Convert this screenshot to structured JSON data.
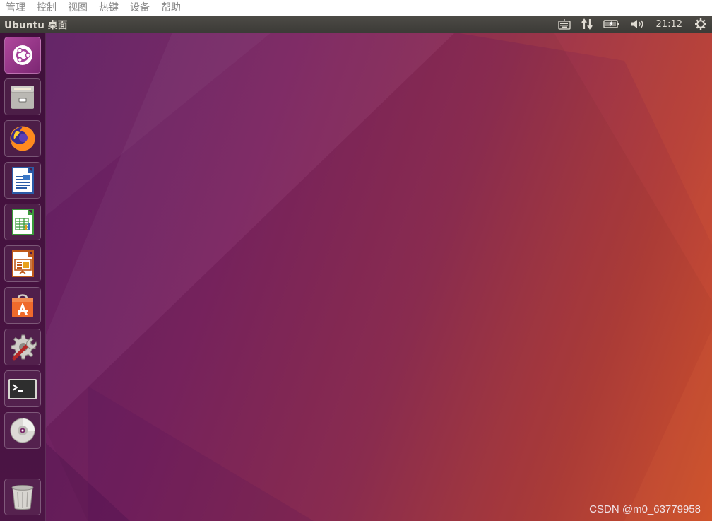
{
  "vbox_menu": {
    "items": [
      "管理",
      "控制",
      "视图",
      "热键",
      "设备",
      "帮助"
    ]
  },
  "top_panel": {
    "title": "Ubuntu 桌面",
    "indicators": [
      "keyboard-icon",
      "network-icon",
      "battery-icon",
      "volume-icon"
    ],
    "clock": "21:12",
    "session_icon": "gear-icon"
  },
  "launcher": {
    "items": [
      "ubuntu-dash-icon",
      "files-icon",
      "firefox-icon",
      "libreoffice-writer-icon",
      "libreoffice-calc-icon",
      "libreoffice-impress-icon",
      "software-center-icon",
      "system-settings-icon",
      "terminal-icon",
      "dvd-icon",
      "trash-icon"
    ]
  },
  "colors": {
    "wallpaper_start": "#5f1f63",
    "wallpaper_end": "#d4532c",
    "panel": "#3c3b37",
    "launcher": "#4c1545"
  },
  "watermark": "CSDN @m0_63779958"
}
